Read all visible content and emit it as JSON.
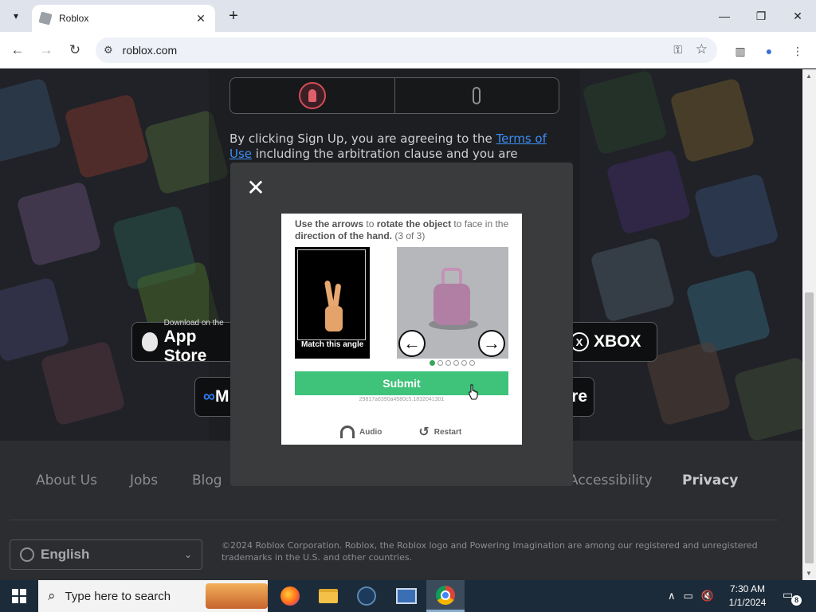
{
  "browser": {
    "tab_title": "Roblox",
    "url": "roblox.com"
  },
  "page": {
    "legal_text_prefix": "By clicking Sign Up, you are agreeing to the ",
    "terms_link": "Terms of Use",
    "legal_text_suffix": " including the arbitration clause and you are",
    "app_store_small": "Download on the",
    "app_store_big": "App Store",
    "xbox_label": "XBOX",
    "meta_label_partial": "M",
    "store_partial": "re",
    "footer_links": [
      "About Us",
      "Jobs",
      "Blog",
      "Accessibility",
      "Privacy"
    ],
    "language": "English",
    "copyright": "©2024 Roblox Corporation. Roblox, the Roblox logo and Powering Imagination are among our registered and unregistered trademarks in the U.S. and other countries."
  },
  "captcha": {
    "instr_part1": "Use the arrows",
    "instr_part2": " to ",
    "instr_part3": "rotate the object",
    "instr_part4": " to face in the ",
    "instr_part5": "direction of the hand.",
    "instr_part6": " (3 of 3)",
    "match_label": "Match this angle",
    "left_arrow": "←",
    "right_arrow": "→",
    "dots_total": 6,
    "dots_active": 1,
    "submit_label": "Submit",
    "session_id": "29817a6390a4580c5.1832041301",
    "audio_label": "Audio",
    "restart_label": "Restart"
  },
  "taskbar": {
    "search_placeholder": "Type here to search",
    "time": "7:30 AM",
    "date": "1/1/2024",
    "notification_count": "8"
  }
}
